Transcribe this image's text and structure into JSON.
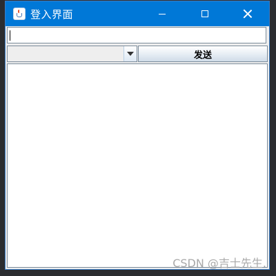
{
  "window": {
    "title": "登入界面",
    "controls": {
      "minimize_icon": "minimize-icon",
      "maximize_icon": "maximize-icon",
      "close_icon": "close-icon"
    },
    "colors": {
      "titlebar": "#0078d7",
      "accent_border": "#3b7fc9"
    }
  },
  "form": {
    "text_field": {
      "value": "",
      "placeholder": ""
    },
    "combo": {
      "selected": ""
    },
    "send_button_label": "发送"
  },
  "watermark": "CSDN @吉士先生."
}
